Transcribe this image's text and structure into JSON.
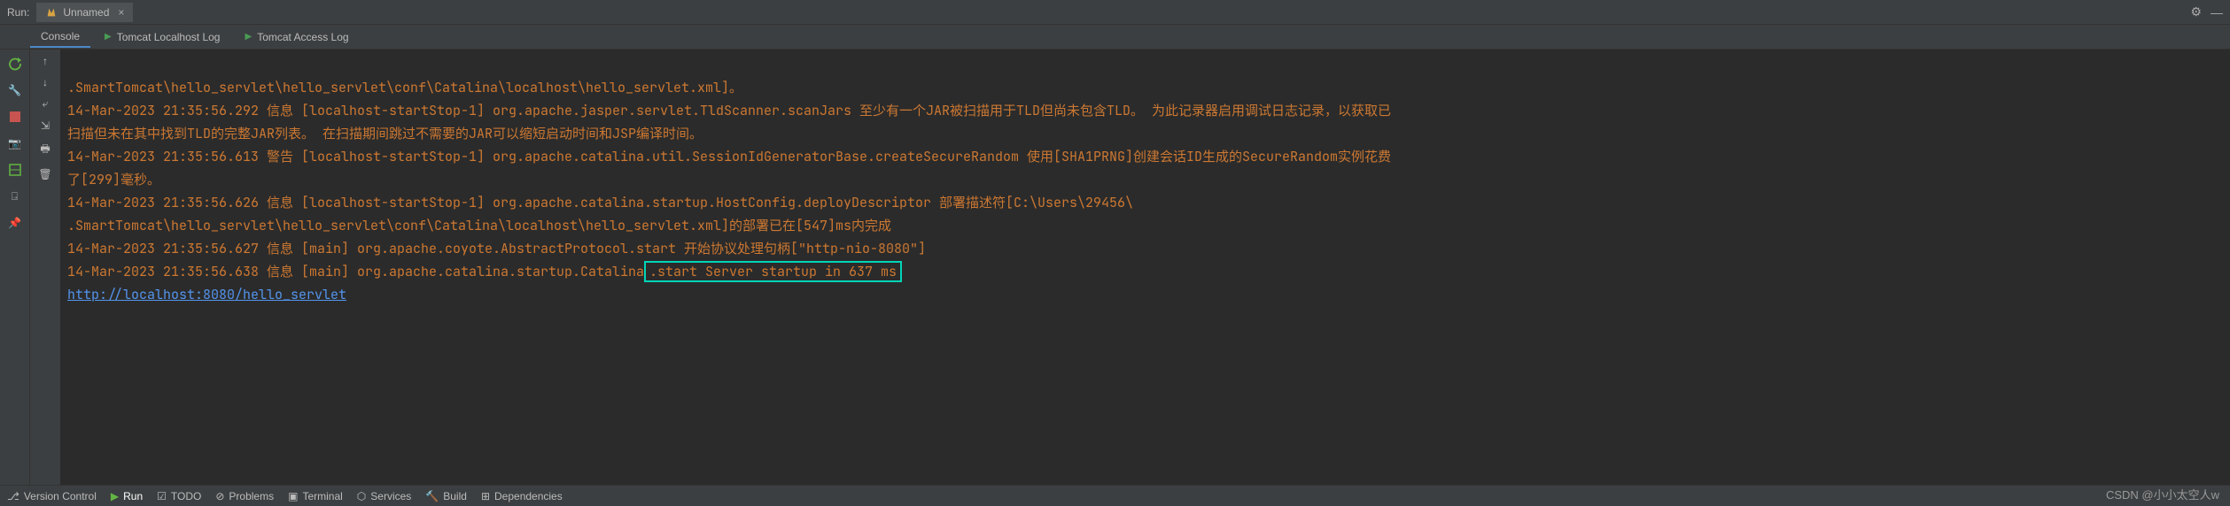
{
  "header": {
    "run_label": "Run:",
    "tab_name": "Unnamed"
  },
  "tabs": {
    "console": "Console",
    "server_log": "Tomcat Localhost Log",
    "access_log": "Tomcat Access Log"
  },
  "console": {
    "line1": ".SmartTomcat\\hello_servlet\\hello_servlet\\conf\\Catalina\\localhost\\hello_servlet.xml]。",
    "line2a": "14-Mar-2023 21:35:56.292 信息 [localhost-startStop-1] org.apache.jasper.servlet.TldScanner.scanJars",
    "line2b": " 至少有一个JAR被扫描用于TLD但尚未包含TLD。 为此记录器启用调试日志记录，以获取已",
    "line3": "扫描但未在其中找到TLD的完整JAR列表。 在扫描期间跳过不需要的JAR可以缩短启动时间和JSP编译时间。",
    "line4a": "14-Mar-2023 21:35:56.613 警告 [localhost-startStop-1] org.apache.catalina.util.SessionIdGeneratorBase.createSecureRandom",
    "line4b": " 使用[SHA1PRNG]创建会话ID生成的SecureRandom实例花费",
    "line5": "了[299]毫秒。",
    "line6a": "14-Mar-2023 21:35:56.626 信息 [localhost-startStop-1] org.apache.catalina.startup.HostConfig.deployDescriptor",
    "line6b": " 部署描述符[C:\\Users\\29456\\",
    "line7": ".SmartTomcat\\hello_servlet\\hello_servlet\\conf\\Catalina\\localhost\\hello_servlet.xml]的部署已在[547]ms内完成",
    "line8a": "14-Mar-2023 21:35:56.627 信息 [main] org.apache.coyote.AbstractProtocol.start",
    "line8b": " 开始协议处理句柄[\"http-nio-8080\"]",
    "line9a": "14-Mar-2023 21:35:56.638 信息 [main] org.apache.catalina.startup.Catalina",
    "line9box": ".start Server startup in 637 ms",
    "link": "http://localhost:8080/hello_servlet"
  },
  "bottom": {
    "version_control": "Version Control",
    "run": "Run",
    "todo": "TODO",
    "problems": "Problems",
    "terminal": "Terminal",
    "services": "Services",
    "build": "Build",
    "dependencies": "Dependencies"
  },
  "watermark": "CSDN @小小太空人w"
}
